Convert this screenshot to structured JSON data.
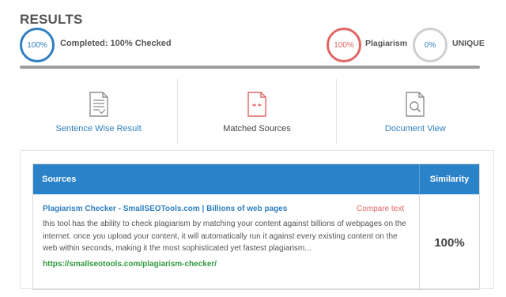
{
  "header": {
    "title": "RESULTS",
    "completed_percent": "100%",
    "completed_label": "Completed: 100% Checked",
    "plagiarism_percent": "100%",
    "plagiarism_label": "Plagiarism",
    "unique_percent": "0%",
    "unique_label": "UNIQUE",
    "progress_fraction": 1.0
  },
  "view_tabs": [
    {
      "label": "Sentence Wise Result",
      "icon": "document-lines-icon",
      "color": "#2f7fc1"
    },
    {
      "label": "Matched Sources",
      "icon": "matched-document-icon",
      "color": "#444444"
    },
    {
      "label": "Document View",
      "icon": "document-search-icon",
      "color": "#2f7fc1"
    }
  ],
  "table": {
    "header_sources": "Sources",
    "header_similarity": "Similarity",
    "rows": [
      {
        "title": "Plagiarism Checker - SmallSEOTools.com | Billions of web pages",
        "compare_label": "Compare text",
        "excerpt": "this tool has the ability to check plagiarism by matching your content against billions of webpages on the internet. once you upload your content, it will automatically run it against every existing content on the web within seconds, making it the most sophisticated yet fastest plagiarism...",
        "url": "https://smallseotools.com/plagiarism-checker/",
        "similarity": "100%"
      }
    ]
  },
  "colors": {
    "accent_blue": "#2f7fc1",
    "header_blue": "#2a82c9",
    "plagiarism_red": "#e06666",
    "url_green": "#2f9a3f"
  }
}
